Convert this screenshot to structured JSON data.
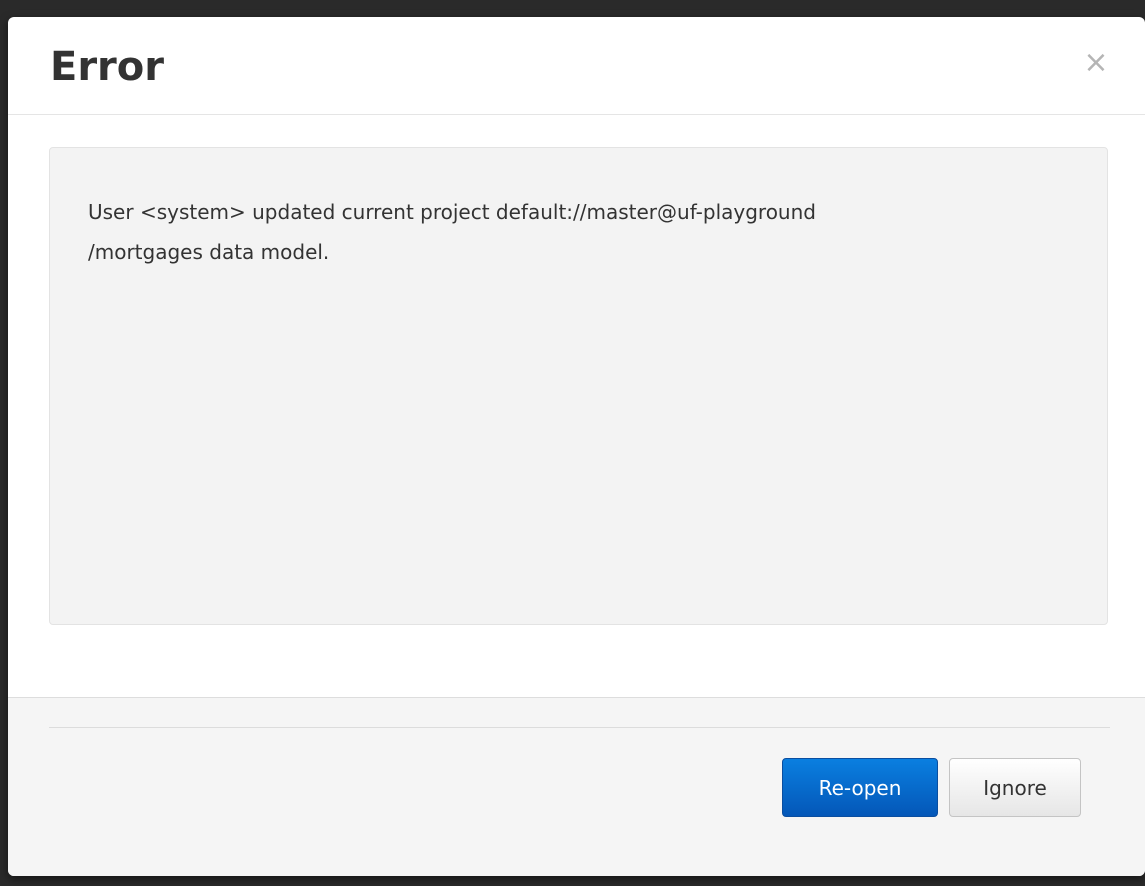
{
  "dialog": {
    "title": "Error",
    "close_symbol": "×",
    "message_line1": "User <system> updated current project default://master@uf-playground",
    "message_line2": "/mortgages data model.",
    "buttons": {
      "reopen_label": "Re-open",
      "ignore_label": "Ignore"
    }
  },
  "colors": {
    "primary_button": "#0566cc",
    "well_background": "#f3f3f3",
    "footer_background": "#f5f5f5"
  }
}
